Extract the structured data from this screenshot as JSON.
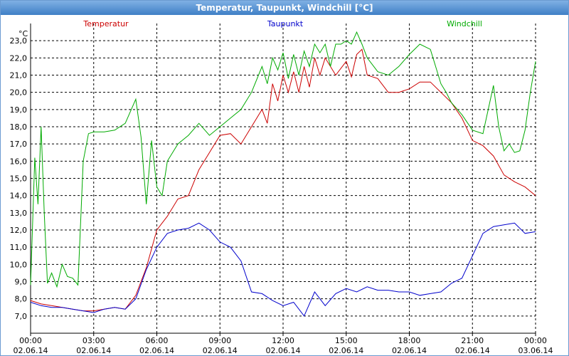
{
  "window": {
    "title": "Temperatur, Taupunkt, Windchill [°C]"
  },
  "chart_data": {
    "type": "line",
    "title": "Temperatur, Taupunkt, Windchill [°C]",
    "unit_label": "°C",
    "ylim": [
      6.0,
      24.0
    ],
    "y_ticks": [
      "7,0",
      "8,0",
      "9,0",
      "10,0",
      "11,0",
      "12,0",
      "13,0",
      "14,0",
      "15,0",
      "16,0",
      "17,0",
      "18,0",
      "19,0",
      "20,0",
      "21,0",
      "22,0",
      "23,0"
    ],
    "x_ticks": [
      {
        "time": "00:00",
        "date": "02.06.14"
      },
      {
        "time": "03:00",
        "date": "02.06.14"
      },
      {
        "time": "06:00",
        "date": "02.06.14"
      },
      {
        "time": "09:00",
        "date": "02.06.14"
      },
      {
        "time": "12:00",
        "date": "02.06.14"
      },
      {
        "time": "15:00",
        "date": "02.06.14"
      },
      {
        "time": "18:00",
        "date": "02.06.14"
      },
      {
        "time": "21:00",
        "date": "02.06.14"
      },
      {
        "time": "00:00",
        "date": "03.06.14"
      }
    ],
    "xlim_hours": [
      0,
      24
    ],
    "grid": true,
    "legend_placement": "top",
    "series": [
      {
        "name": "Temperatur",
        "color": "#cc0000",
        "x": [
          0,
          0.5,
          1,
          1.5,
          2,
          2.5,
          3,
          3.5,
          4,
          4.5,
          5,
          5.5,
          6,
          6.5,
          7,
          7.5,
          8,
          8.5,
          9,
          9.5,
          10,
          10.5,
          11,
          11.25,
          11.5,
          11.75,
          12,
          12.25,
          12.5,
          12.75,
          13,
          13.25,
          13.5,
          13.75,
          14,
          14.5,
          15,
          15.25,
          15.5,
          15.75,
          16,
          16.5,
          17,
          17.5,
          18,
          18.5,
          19,
          19.5,
          20,
          20.5,
          21,
          21.5,
          22,
          22.5,
          23,
          23.5,
          24
        ],
        "values": [
          7.9,
          7.7,
          7.6,
          7.5,
          7.4,
          7.3,
          7.3,
          7.4,
          7.5,
          7.4,
          8.2,
          9.8,
          12.0,
          12.8,
          13.8,
          14.0,
          15.5,
          16.5,
          17.5,
          17.6,
          17.0,
          18.0,
          19.0,
          18.2,
          20.5,
          19.5,
          21.0,
          20.0,
          21.2,
          20.0,
          21.5,
          20.3,
          22.0,
          21.0,
          22.0,
          21.0,
          21.8,
          20.9,
          22.2,
          22.5,
          21.0,
          20.8,
          20.0,
          20.0,
          20.2,
          20.6,
          20.6,
          20.0,
          19.4,
          18.5,
          17.2,
          16.9,
          16.3,
          15.2,
          14.8,
          14.5,
          14.0
        ]
      },
      {
        "name": "Taupunkt",
        "color": "#0000cc",
        "x": [
          0,
          0.5,
          1,
          1.5,
          2,
          2.5,
          3,
          3.5,
          4,
          4.5,
          5,
          5.5,
          6,
          6.5,
          7,
          7.5,
          8,
          8.5,
          9,
          9.5,
          10,
          10.5,
          11,
          11.5,
          12,
          12.5,
          13,
          13.5,
          14,
          14.5,
          15,
          15.5,
          16,
          16.5,
          17,
          17.5,
          18,
          18.5,
          19,
          19.5,
          20,
          20.5,
          21,
          21.5,
          22,
          22.5,
          23,
          23.5,
          24
        ],
        "values": [
          7.8,
          7.6,
          7.5,
          7.5,
          7.4,
          7.3,
          7.2,
          7.4,
          7.5,
          7.4,
          8.0,
          9.7,
          11.0,
          11.8,
          12.0,
          12.1,
          12.4,
          12.0,
          11.3,
          11.0,
          10.2,
          8.4,
          8.3,
          7.9,
          7.6,
          7.8,
          7.0,
          8.4,
          7.6,
          8.3,
          8.6,
          8.4,
          8.7,
          8.5,
          8.5,
          8.4,
          8.4,
          8.2,
          8.3,
          8.4,
          8.9,
          9.2,
          10.5,
          11.8,
          12.2,
          12.3,
          12.4,
          11.8,
          11.9
        ]
      },
      {
        "name": "Windchill",
        "color": "#00aa00",
        "x": [
          0,
          0.2,
          0.35,
          0.5,
          0.65,
          0.8,
          1,
          1.25,
          1.5,
          1.75,
          2,
          2.25,
          2.5,
          2.75,
          3,
          3.5,
          4,
          4.5,
          5,
          5.25,
          5.5,
          5.75,
          6,
          6.25,
          6.5,
          6.75,
          7,
          7.5,
          8,
          8.5,
          9,
          9.5,
          10,
          10.5,
          11,
          11.25,
          11.5,
          11.75,
          12,
          12.25,
          12.5,
          12.75,
          13,
          13.25,
          13.5,
          13.75,
          14,
          14.25,
          14.5,
          14.75,
          15,
          15.25,
          15.5,
          15.75,
          16,
          16.5,
          17,
          17.5,
          18,
          18.5,
          19,
          19.25,
          19.5,
          19.75,
          20,
          20.5,
          21,
          21.5,
          22,
          22.25,
          22.5,
          22.75,
          23,
          23.25,
          23.5,
          23.75,
          24
        ],
        "values": [
          8.8,
          16.2,
          13.5,
          18.0,
          13.0,
          8.9,
          9.5,
          8.7,
          10.0,
          9.3,
          9.2,
          8.8,
          16.0,
          17.6,
          17.7,
          17.7,
          17.8,
          18.2,
          19.6,
          17.4,
          13.5,
          17.2,
          14.5,
          14.0,
          16.0,
          16.5,
          17.0,
          17.5,
          18.2,
          17.5,
          18.0,
          18.5,
          19.0,
          20.0,
          21.5,
          20.5,
          22.0,
          21.3,
          22.3,
          20.8,
          22.2,
          21.0,
          22.4,
          21.5,
          22.8,
          22.3,
          22.8,
          21.5,
          22.8,
          22.8,
          23.0,
          22.8,
          23.5,
          22.8,
          22.0,
          21.2,
          21.0,
          21.5,
          22.2,
          22.8,
          22.5,
          21.5,
          20.5,
          20.0,
          19.4,
          18.7,
          17.8,
          17.6,
          20.4,
          18.0,
          16.6,
          17.0,
          16.5,
          16.6,
          17.8,
          20.0,
          21.8
        ]
      }
    ]
  }
}
